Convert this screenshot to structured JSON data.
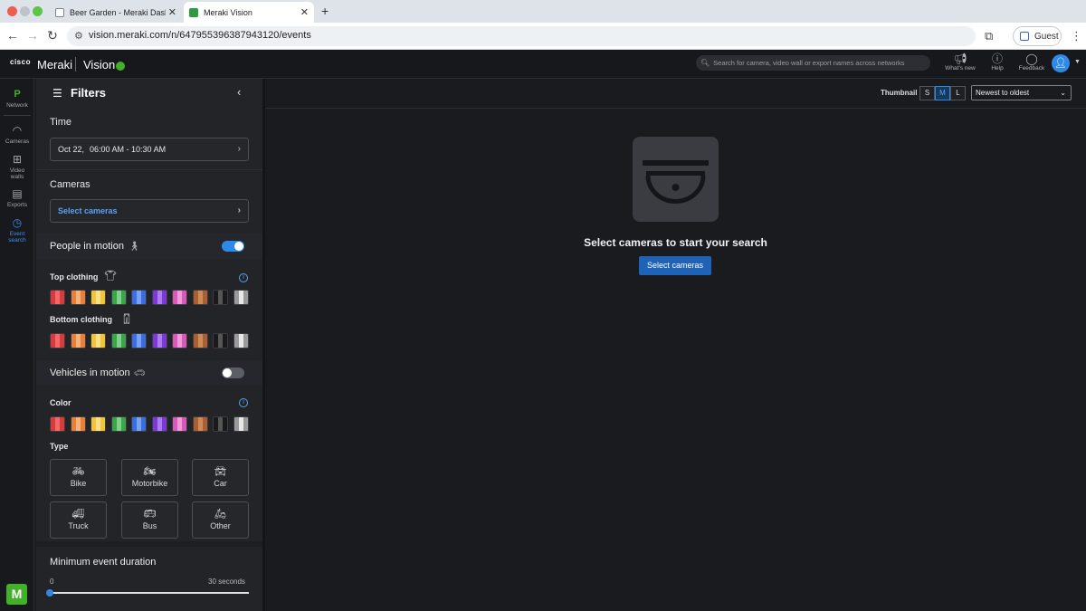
{
  "browser": {
    "tabs": [
      {
        "title": "Beer Garden - Meraki Dashbo"
      },
      {
        "title": "Meraki Vision"
      }
    ],
    "url": "vision.meraki.com/n/647955396387943120/events",
    "guest_label": "Guest"
  },
  "header": {
    "cisco": "cisco",
    "brand": "Meraki",
    "product": "Vision",
    "search_placeholder": "Search for camera, video wall or export names across networks",
    "whats_new": "What's new",
    "help": "Help",
    "feedback": "Feedback"
  },
  "rail": {
    "network_letter": "P",
    "network": "Network",
    "cameras": "Cameras",
    "video_walls_1": "Video",
    "video_walls_2": "walls",
    "exports": "Exports",
    "event_1": "Event",
    "event_2": "search",
    "logo_letter": "M"
  },
  "filters": {
    "title": "Filters",
    "time_title": "Time",
    "time_date": "Oct 22,",
    "time_range": "06:00 AM - 10:30 AM",
    "cameras_title": "Cameras",
    "cameras_select": "Select cameras",
    "people_motion": "People in motion",
    "people_on": true,
    "top_clothing": "Top clothing",
    "bottom_clothing": "Bottom clothing",
    "vehicles_motion": "Vehicles in motion",
    "vehicles_on": false,
    "color": "Color",
    "type": "Type",
    "types": [
      "Bike",
      "Motorbike",
      "Car",
      "Truck",
      "Bus",
      "Other"
    ],
    "min_duration": "Minimum event duration",
    "slider_min": "0",
    "slider_max": "30 seconds",
    "slider_value": 0
  },
  "swatch_colors": [
    [
      "#d93a3a",
      "#f06a6a"
    ],
    [
      "#e9803a",
      "#f6b27a"
    ],
    [
      "#f1c53a",
      "#f8e08a"
    ],
    [
      "#3aa64a",
      "#7ed08a"
    ],
    [
      "#3a6ee0",
      "#7aa3f2"
    ],
    [
      "#7a3ad8",
      "#b07af0"
    ],
    [
      "#d85ab8",
      "#f09ad8"
    ],
    [
      "#a86030",
      "#d08a5a"
    ],
    [
      "#1a1a1a",
      "#555555"
    ],
    [
      "#9a9a9a",
      "#e8e8e8"
    ]
  ],
  "main": {
    "thumbnail_label": "Thumbnail",
    "sizes": [
      "S",
      "M",
      "L"
    ],
    "active_size": "M",
    "sort": "Newest to oldest",
    "empty_message": "Select cameras to start your search",
    "cta": "Select cameras"
  }
}
